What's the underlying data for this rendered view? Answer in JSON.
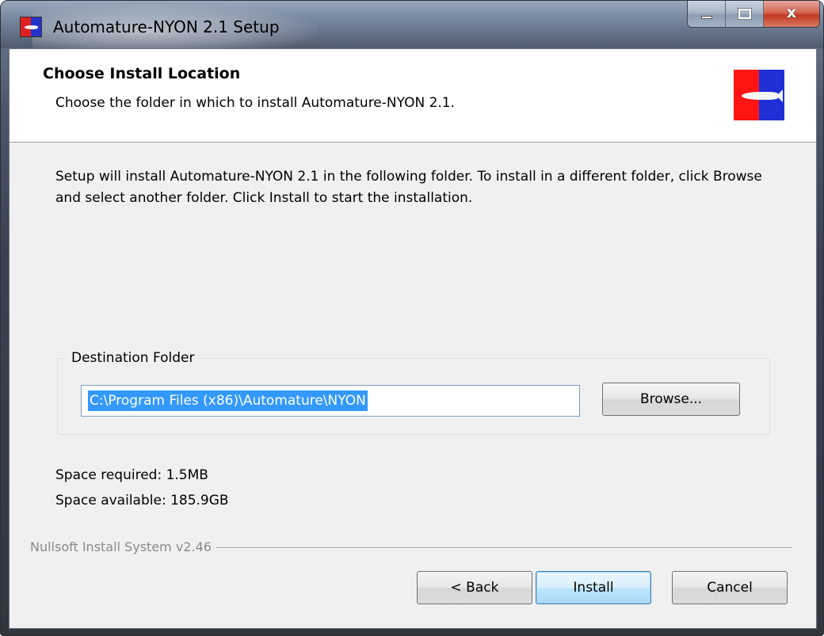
{
  "window": {
    "title": "Automature-NYON 2.1 Setup",
    "close_glyph": "x"
  },
  "header": {
    "title": "Choose Install Location",
    "subtitle": "Choose the folder in which to install Automature-NYON 2.1."
  },
  "intro_text": "Setup will install Automature-NYON 2.1 in the following folder. To install in a different folder, click Browse and select another folder. Click Install to start the installation.",
  "destination": {
    "group_label": "Destination Folder",
    "path_value": "C:\\Program Files (x86)\\Automature\\NYON",
    "browse_label": "Browse..."
  },
  "space": {
    "required": "Space required: 1.5MB",
    "available": "Space available: 185.9GB"
  },
  "branding": "Nullsoft Install System v2.46",
  "buttons": {
    "back": "< Back",
    "install": "Install",
    "cancel": "Cancel"
  },
  "colors": {
    "icon_red": "#ff1414",
    "icon_blue": "#1e2fd6",
    "selection": "#3399ff"
  }
}
